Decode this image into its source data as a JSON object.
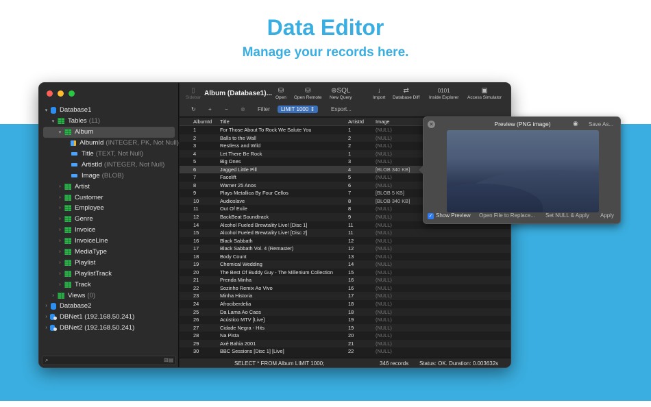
{
  "marketing": {
    "headline": "Data Editor",
    "subheadline": "Manage your records here."
  },
  "colors": {
    "accent": "#3aaee0",
    "selection": "#3b6fb7"
  },
  "toolbar": {
    "sidebar_label": "Sidebar",
    "title": "Album (Database1)...",
    "open": "Open",
    "open_remote": "Open Remote",
    "new_query": "New Query",
    "new_query_glyph": "⊕SQL",
    "import": "Import",
    "database_diff": "Database Diff",
    "inside_explorer": "Inside Explorer",
    "inside_explorer_glyph": "0101",
    "access_simulator": "Access Simulator",
    "filter_label": "Filter",
    "limit_label": "LIMIT 1000",
    "export_label": "Export..."
  },
  "tree": [
    {
      "label": "Database1",
      "meta": "",
      "level": 0,
      "chev": "▾",
      "icon": "db"
    },
    {
      "label": "Tables",
      "meta": "(11)",
      "level": 1,
      "chev": "▾",
      "icon": "tbl"
    },
    {
      "label": "Album",
      "meta": "",
      "level": 2,
      "chev": "▾",
      "icon": "tbl",
      "selected": true
    },
    {
      "label": "AlbumId",
      "meta": "(INTEGER, PK, Not Null)",
      "level": 3,
      "chev": "",
      "icon": "pk"
    },
    {
      "label": "Title",
      "meta": "(TEXT, Not Null)",
      "level": 3,
      "chev": "",
      "icon": "col"
    },
    {
      "label": "ArtistId",
      "meta": "(INTEGER, Not Null)",
      "level": 3,
      "chev": "",
      "icon": "col"
    },
    {
      "label": "Image",
      "meta": "(BLOB)",
      "level": 3,
      "chev": "",
      "icon": "col"
    },
    {
      "label": "Artist",
      "meta": "",
      "level": 2,
      "chev": "›",
      "icon": "tbl"
    },
    {
      "label": "Customer",
      "meta": "",
      "level": 2,
      "chev": "›",
      "icon": "tbl"
    },
    {
      "label": "Employee",
      "meta": "",
      "level": 2,
      "chev": "›",
      "icon": "tbl"
    },
    {
      "label": "Genre",
      "meta": "",
      "level": 2,
      "chev": "›",
      "icon": "tbl"
    },
    {
      "label": "Invoice",
      "meta": "",
      "level": 2,
      "chev": "›",
      "icon": "tbl"
    },
    {
      "label": "InvoiceLine",
      "meta": "",
      "level": 2,
      "chev": "›",
      "icon": "tbl"
    },
    {
      "label": "MediaType",
      "meta": "",
      "level": 2,
      "chev": "›",
      "icon": "tbl"
    },
    {
      "label": "Playlist",
      "meta": "",
      "level": 2,
      "chev": "›",
      "icon": "tbl"
    },
    {
      "label": "PlaylistTrack",
      "meta": "",
      "level": 2,
      "chev": "›",
      "icon": "tbl"
    },
    {
      "label": "Track",
      "meta": "",
      "level": 2,
      "chev": "›",
      "icon": "tbl"
    },
    {
      "label": "Views",
      "meta": "(0)",
      "level": 1,
      "chev": "›",
      "icon": "tbl"
    },
    {
      "label": "Database2",
      "meta": "",
      "level": 0,
      "chev": "›",
      "icon": "db"
    },
    {
      "label": "DBNet1 (192.168.50.241)",
      "meta": "",
      "level": 0,
      "chev": "›",
      "icon": "dbnet"
    },
    {
      "label": "DBNet2 (192.168.50.241)",
      "meta": "",
      "level": 0,
      "chev": "›",
      "icon": "dbnet"
    }
  ],
  "table": {
    "columns": [
      "AlbumId",
      "Title",
      "ArtistId",
      "Image"
    ],
    "rows": [
      [
        "1",
        "For Those About To Rock We Salute You",
        "1",
        "(NULL)"
      ],
      [
        "2",
        "Balls to the Wall",
        "2",
        "(NULL)"
      ],
      [
        "3",
        "Restless and Wild",
        "2",
        "(NULL)"
      ],
      [
        "4",
        "Let There Be Rock",
        "1",
        "(NULL)"
      ],
      [
        "5",
        "Big Ones",
        "3",
        "(NULL)"
      ],
      [
        "6",
        "Jagged Little Pill",
        "4",
        "[BLOB 340 KB]"
      ],
      [
        "7",
        "Facelift",
        "5",
        "(NULL)"
      ],
      [
        "8",
        "Warner 25 Anos",
        "6",
        "(NULL)"
      ],
      [
        "9",
        "Plays Metallica By Four Cellos",
        "7",
        "[BLOB 5 KB]"
      ],
      [
        "10",
        "Audioslave",
        "8",
        "[BLOB 340 KB]"
      ],
      [
        "11",
        "Out Of Exile",
        "8",
        "(NULL)"
      ],
      [
        "12",
        "BackBeat Soundtrack",
        "9",
        "(NULL)"
      ],
      [
        "14",
        "Alcohol Fueled Brewtality Live! [Disc 1]",
        "11",
        "(NULL)"
      ],
      [
        "15",
        "Alcohol Fueled Brewtality Live! [Disc 2]",
        "11",
        "(NULL)"
      ],
      [
        "16",
        "Black Sabbath",
        "12",
        "(NULL)"
      ],
      [
        "17",
        "Black Sabbath Vol. 4 (Remaster)",
        "12",
        "(NULL)"
      ],
      [
        "18",
        "Body Count",
        "13",
        "(NULL)"
      ],
      [
        "19",
        "Chemical Wedding",
        "14",
        "(NULL)"
      ],
      [
        "20",
        "The Best Of Buddy Guy - The Millenium Collection",
        "15",
        "(NULL)"
      ],
      [
        "21",
        "Prenda Minha",
        "16",
        "(NULL)"
      ],
      [
        "22",
        "Sozinho Remix Ao Vivo",
        "16",
        "(NULL)"
      ],
      [
        "23",
        "Minha Historia",
        "17",
        "(NULL)"
      ],
      [
        "24",
        "Afrociberdelia",
        "18",
        "(NULL)"
      ],
      [
        "25",
        "Da Lama Ao Caos",
        "18",
        "(NULL)"
      ],
      [
        "26",
        "Acústico MTV [Live]",
        "19",
        "(NULL)"
      ],
      [
        "27",
        "Cidade Negra - Hits",
        "19",
        "(NULL)"
      ],
      [
        "28",
        "Na Pista",
        "20",
        "(NULL)"
      ],
      [
        "29",
        "Axé Bahia 2001",
        "21",
        "(NULL)"
      ],
      [
        "30",
        "BBC Sessions [Disc 1] [Live]",
        "22",
        "(NULL)"
      ]
    ],
    "selected_row": 5
  },
  "status": {
    "query": "SELECT * FROM Album LIMIT 1000;",
    "records": "346 records",
    "result": "Status: OK.  Duration: 0.003632s"
  },
  "preview": {
    "title": "Preview (PNG image)",
    "save_as": "Save As...",
    "show_preview": "Show Preview",
    "open_file": "Open File to Replace...",
    "set_null": "Set NULL & Apply",
    "apply": "Apply"
  }
}
